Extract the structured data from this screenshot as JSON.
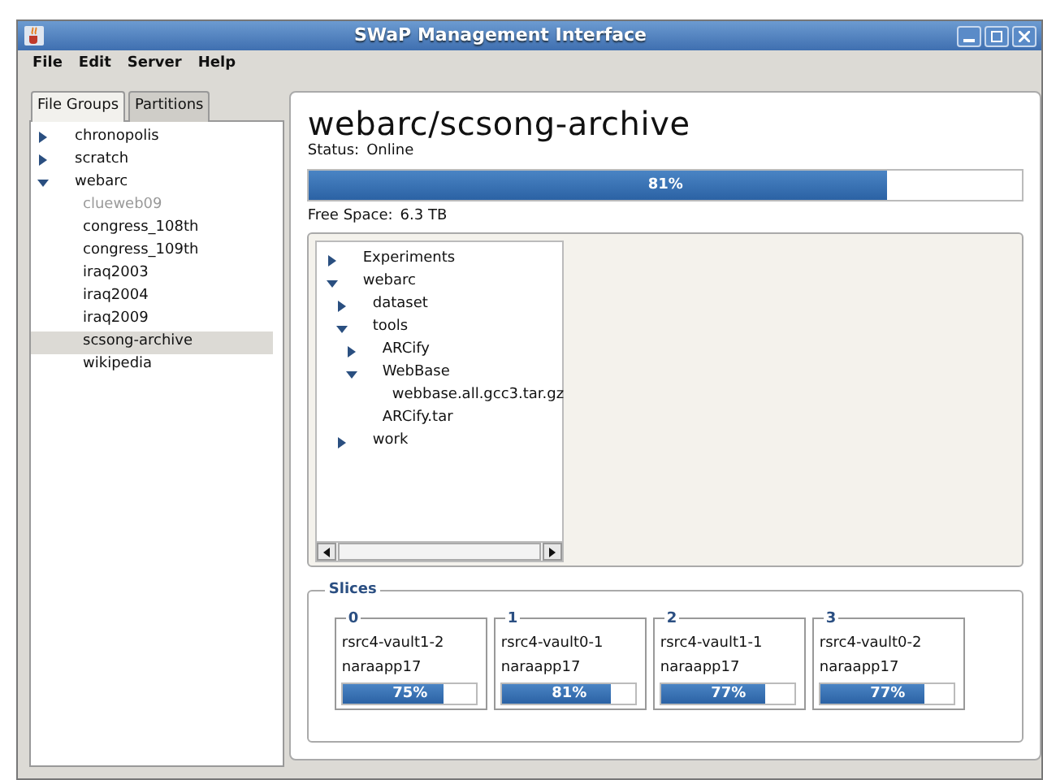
{
  "window": {
    "title": "SWaP Management Interface"
  },
  "menu": [
    "File",
    "Edit",
    "Server",
    "Help"
  ],
  "tabs": [
    {
      "label": "File Groups",
      "selected": true
    },
    {
      "label": "Partitions",
      "selected": false
    }
  ],
  "file_groups": [
    {
      "label": "chronopolis",
      "expanded": false,
      "selected": false,
      "disabled": false
    },
    {
      "label": "scratch",
      "expanded": false,
      "selected": false,
      "disabled": false
    },
    {
      "label": "webarc",
      "expanded": true,
      "selected": false,
      "disabled": false,
      "children": [
        {
          "label": "clueweb09",
          "selected": false,
          "disabled": true
        },
        {
          "label": "congress_108th",
          "selected": false,
          "disabled": false
        },
        {
          "label": "congress_109th",
          "selected": false,
          "disabled": false
        },
        {
          "label": "iraq2003",
          "selected": false,
          "disabled": false
        },
        {
          "label": "iraq2004",
          "selected": false,
          "disabled": false
        },
        {
          "label": "iraq2009",
          "selected": false,
          "disabled": false
        },
        {
          "label": "scsong-archive",
          "selected": true,
          "disabled": false
        },
        {
          "label": "wikipedia",
          "selected": false,
          "disabled": false
        }
      ]
    }
  ],
  "detail": {
    "title": "webarc/scsong-archive",
    "status_label": "Status:",
    "status": "Online",
    "usage": {
      "level": 0.81,
      "reading": "81%"
    },
    "free_label": "Free Space:",
    "free": "6.3 TB",
    "files": [
      {
        "label": "Experiments",
        "expanded": false
      },
      {
        "label": "webarc",
        "expanded": true,
        "children": [
          {
            "label": "dataset",
            "expanded": false
          },
          {
            "label": "tools",
            "expanded": true,
            "children": [
              {
                "label": "ARCify",
                "expanded": false
              },
              {
                "label": "WebBase",
                "expanded": true,
                "children": [
                  {
                    "label": "webbase.all.gcc3.tar.gz"
                  }
                ]
              },
              {
                "label": "ARCify.tar"
              }
            ]
          },
          {
            "label": "work",
            "expanded": false
          }
        ]
      }
    ],
    "slices_title": "Slices",
    "slices": [
      {
        "index": "0",
        "name": "rsrc4-vault1-2",
        "host": "naraapp17",
        "level": 0.75,
        "reading": "75%"
      },
      {
        "index": "1",
        "name": "rsrc4-vault0-1",
        "host": "naraapp17",
        "level": 0.81,
        "reading": "81%"
      },
      {
        "index": "2",
        "name": "rsrc4-vault1-1",
        "host": "naraapp17",
        "level": 0.77,
        "reading": "77%"
      },
      {
        "index": "3",
        "name": "rsrc4-vault0-2",
        "host": "naraapp17",
        "level": 0.77,
        "reading": "77%"
      }
    ]
  }
}
